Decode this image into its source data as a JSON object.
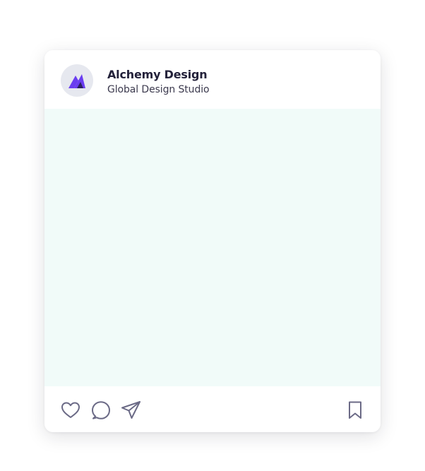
{
  "post": {
    "account_name": "Alchemy Design",
    "account_subtitle": "Global Design Studio",
    "avatar_icon": "alchemy-logo-icon",
    "media_color": "#f1fbf9"
  },
  "actions": {
    "like_icon": "heart-icon",
    "comment_icon": "speech-bubble-icon",
    "share_icon": "paper-plane-icon",
    "save_icon": "bookmark-icon"
  },
  "colors": {
    "icon_stroke": "#6b6a86",
    "logo_primary": "#6a3df0",
    "logo_dark": "#2a2161",
    "avatar_bg": "#e6e8ef"
  }
}
